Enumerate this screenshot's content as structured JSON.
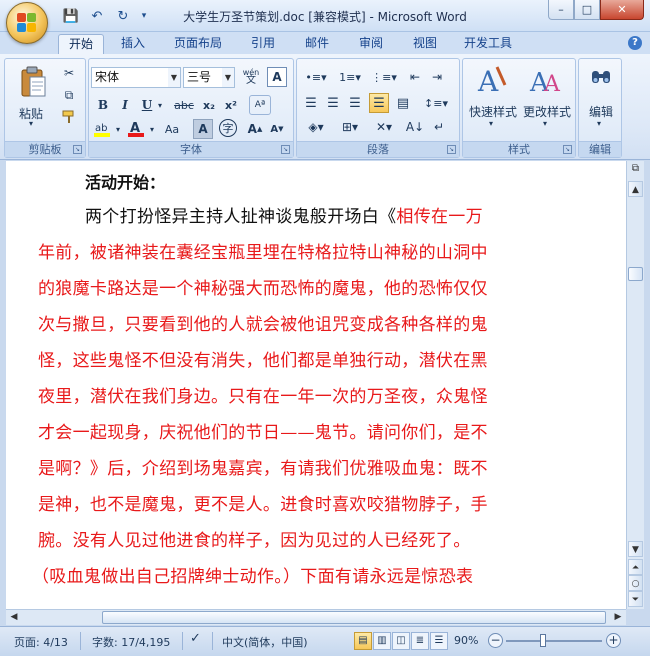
{
  "window": {
    "title": "大学生万圣节策划.doc [兼容模式] - Microsoft Word",
    "controls": {
      "minimize": "–",
      "maximize": "□",
      "close": "✕"
    }
  },
  "quick_access": {
    "save": "💾",
    "undo": "↶",
    "redo": "↻",
    "customize": "▾"
  },
  "tabs": [
    "开始",
    "插入",
    "页面布局",
    "引用",
    "邮件",
    "审阅",
    "视图",
    "开发工具"
  ],
  "active_tab": "开始",
  "ribbon": {
    "clipboard": {
      "label": "剪贴板",
      "paste": "粘贴"
    },
    "font": {
      "label": "字体",
      "font_name": "宋体",
      "font_size": "三号",
      "wen": "wén",
      "bold": "B",
      "italic": "I",
      "underline": "U",
      "strike": "abc",
      "subscript": "x₂",
      "superscript": "x²",
      "grow": "A",
      "shrink": "A",
      "case": "Aa",
      "clear": "A"
    },
    "paragraph": {
      "label": "段落"
    },
    "styles": {
      "label": "样式",
      "quick": "快速样式",
      "change": "更改样式"
    },
    "editing": {
      "label": "编辑",
      "edit": "编辑"
    }
  },
  "document": {
    "heading": "活动开始：",
    "lines": [
      {
        "text": "两个打扮怪异主持人扯神谈鬼般开场白《",
        "rest": "相传在一万",
        "black": true
      },
      {
        "text": "年前，被诸神装在囊经宝瓶里埋在特格拉特山神秘的山洞中"
      },
      {
        "text": "的狼魔卡路达是一个神秘强大而恐怖的魔鬼，他的恐怖仅仅"
      },
      {
        "text": "次与撒旦，只要看到他的人就会被他诅咒变成各种各样的鬼"
      },
      {
        "text": "怪，这些鬼怪不但没有消失，他们都是单独行动，潜伏在黑"
      },
      {
        "text": "夜里，潜伏在我们身边。只有在一年一次的万圣夜，众鬼怪"
      },
      {
        "text": "才会一起现身，庆祝他们的节日——鬼节。请问你们，是不"
      },
      {
        "text": "是啊？》后，介绍到场鬼嘉宾，有请我们优雅吸血鬼：既不"
      },
      {
        "text": "是神，也不是魔鬼，更不是人。进食时喜欢咬猎物脖子，手"
      },
      {
        "text": "腕。没有人见过他进食的样子，因为见过的人已经死了。"
      },
      {
        "text": "（吸血鬼做出自己招牌绅士动作。）下面有请永远是惊恐表"
      }
    ]
  },
  "status_bar": {
    "page": "页面: 4/13",
    "words": "字数: 17/4,195",
    "language": "中文(简体，中国)",
    "zoom": "90%"
  }
}
